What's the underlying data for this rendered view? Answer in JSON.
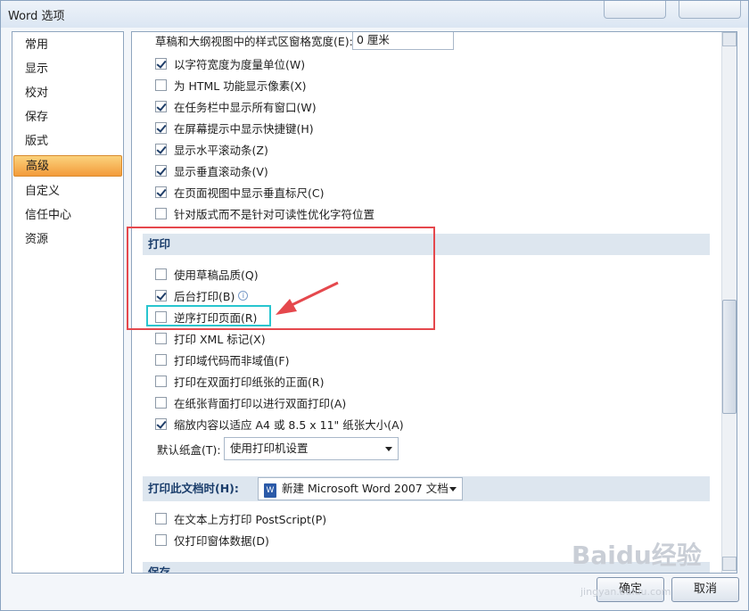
{
  "window": {
    "title": "Word 选项"
  },
  "sidebar": {
    "items": [
      {
        "label": "常用",
        "active": false
      },
      {
        "label": "显示",
        "active": false
      },
      {
        "label": "校对",
        "active": false
      },
      {
        "label": "保存",
        "active": false
      },
      {
        "label": "版式",
        "active": false
      },
      {
        "label": "高级",
        "active": true
      },
      {
        "label": "自定义",
        "active": false
      },
      {
        "label": "信任中心",
        "active": false
      },
      {
        "label": "资源",
        "active": false
      }
    ]
  },
  "display_options": {
    "style_pane_label": "草稿和大纲视图中的样式区窗格宽度(E):",
    "style_pane_value": "0 厘米",
    "items": [
      {
        "label": "以字符宽度为度量单位(W)",
        "checked": true
      },
      {
        "label": "为 HTML 功能显示像素(X)",
        "checked": false
      },
      {
        "label": "在任务栏中显示所有窗口(W)",
        "checked": true
      },
      {
        "label": "在屏幕提示中显示快捷键(H)",
        "checked": true
      },
      {
        "label": "显示水平滚动条(Z)",
        "checked": true
      },
      {
        "label": "显示垂直滚动条(V)",
        "checked": true
      },
      {
        "label": "在页面视图中显示垂直标尺(C)",
        "checked": true
      },
      {
        "label": "针对版式而不是针对可读性优化字符位置",
        "checked": false
      }
    ]
  },
  "print_section": {
    "title": "打印",
    "items": [
      {
        "label": "使用草稿品质(Q)",
        "checked": false
      },
      {
        "label": "后台打印(B)",
        "checked": true
      },
      {
        "label": "逆序打印页面(R)",
        "checked": false
      },
      {
        "label": "打印 XML 标记(X)",
        "checked": false
      },
      {
        "label": "打印域代码而非域值(F)",
        "checked": false
      },
      {
        "label": "打印在双面打印纸张的正面(R)",
        "checked": false
      },
      {
        "label": "在纸张背面打印以进行双面打印(A)",
        "checked": false
      },
      {
        "label": "缩放内容以适应 A4 或 8.5 x 11\" 纸张大小(A)",
        "checked": true
      }
    ],
    "tray_label": "默认纸盒(T):",
    "tray_value": "使用打印机设置"
  },
  "print_doc_section": {
    "title": "打印此文档时(H):",
    "doc_value": "新建 Microsoft Word 2007 文档",
    "doc_icon": "W",
    "items": [
      {
        "label": "在文本上方打印 PostScript(P)",
        "checked": false
      },
      {
        "label": "仅打印窗体数据(D)",
        "checked": false
      }
    ]
  },
  "save_section": {
    "title": "保存"
  },
  "buttons": {
    "ok": "确定",
    "cancel": "取消"
  },
  "watermark": {
    "brand": "Baidu经验",
    "url": "jingyan.baidu.com"
  },
  "annotation_colors": {
    "red": "#e5484d",
    "cyan": "#28c5cf"
  }
}
